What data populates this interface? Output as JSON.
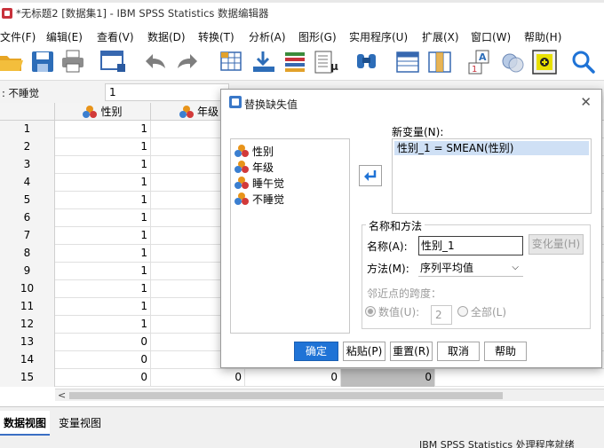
{
  "window": {
    "title": "*无标题2 [数据集1] - IBM SPSS Statistics 数据编辑器"
  },
  "menu": [
    "文件(F)",
    "编辑(E)",
    "查看(V)",
    "数据(D)",
    "转换(T)",
    "分析(A)",
    "图形(G)",
    "实用程序(U)",
    "扩展(X)",
    "窗口(W)",
    "帮助(H)"
  ],
  "toolbar_icons": [
    "open-folder-icon",
    "save-icon",
    "print-icon",
    "dialog-recall-icon",
    "undo-icon",
    "redo-icon",
    "goto-case-icon",
    "goto-variable-icon",
    "variables-icon",
    "run-descriptives-icon",
    "find-icon",
    "insert-cases-icon",
    "insert-variable-icon",
    "split-file-icon",
    "select-cases-icon",
    "value-labels-icon",
    "search-icon"
  ],
  "cellbar": {
    "ref": ": 不睡觉",
    "value": "1"
  },
  "grid": {
    "columns": [
      "性别",
      "年级"
    ],
    "rows": [
      {
        "n": "1",
        "a": "1"
      },
      {
        "n": "2",
        "a": "1"
      },
      {
        "n": "3",
        "a": "1"
      },
      {
        "n": "4",
        "a": "1"
      },
      {
        "n": "5",
        "a": "1"
      },
      {
        "n": "6",
        "a": "1"
      },
      {
        "n": "7",
        "a": "1"
      },
      {
        "n": "8",
        "a": "1"
      },
      {
        "n": "9",
        "a": "1"
      },
      {
        "n": "10",
        "a": "1"
      },
      {
        "n": "11",
        "a": "1"
      },
      {
        "n": "12",
        "a": "1"
      },
      {
        "n": "13",
        "a": "0"
      },
      {
        "n": "14",
        "a": "0"
      },
      {
        "n": "15",
        "a": "0",
        "b": "0",
        "c": "0",
        "d": "0"
      }
    ],
    "scroll_left": "<"
  },
  "tabs": {
    "data_view": "数据视图",
    "variable_view": "变量视图"
  },
  "status": "IBM SPSS Statistics 处理程序就绪",
  "dialog": {
    "title": "替换缺失值",
    "variables": [
      "性别",
      "年级",
      "睡午觉",
      "不睡觉"
    ],
    "new_vars_label": "新变量(N):",
    "new_var_entry": "性别_1 = SMEAN(性别)",
    "group_title": "名称和方法",
    "name_label": "名称(A):",
    "name_value": "性别_1",
    "change_button": "变化量(H)",
    "method_label": "方法(M):",
    "method_value": "序列平均值",
    "span_label": "邻近点的跨度：",
    "radio_number": "数值(U):",
    "span_value": "2",
    "radio_all": "全部(L)",
    "buttons": [
      "确定",
      "粘贴(P)",
      "重置(R)",
      "取消",
      "帮助"
    ]
  }
}
